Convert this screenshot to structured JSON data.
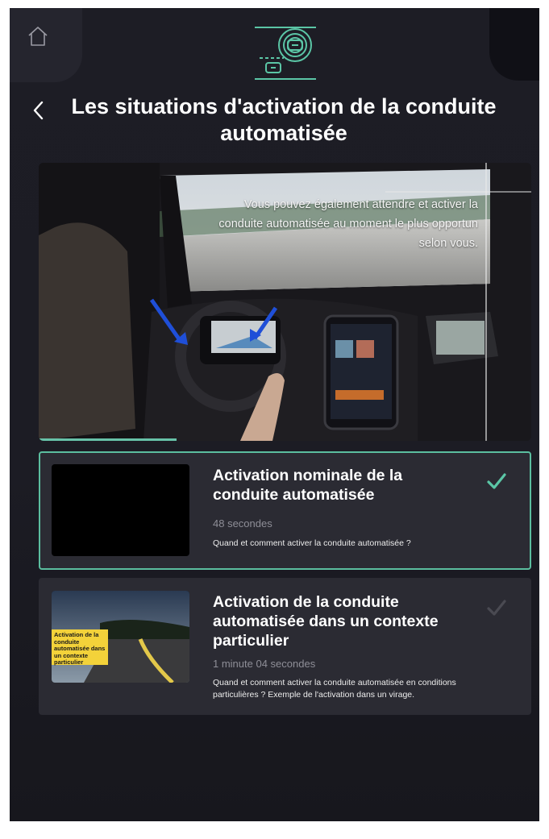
{
  "header": {
    "title": "Les situations d'activation de la conduite automatisée",
    "home_icon": "home-icon",
    "back_icon": "chevron-left-icon",
    "logo_icon": "autonomous-car-logo-icon"
  },
  "video": {
    "caption": "Vous pouvez également attendre et activer la conduite automatisée au moment le plus opportun selon vous.",
    "progress": 0.28,
    "accent_color": "#67c2a8"
  },
  "lessons": [
    {
      "title": "Activation nominale de la conduite automatisée",
      "duration": "48 secondes",
      "description": "Quand et comment activer la conduite automatisée ?",
      "completed": true,
      "active": true
    },
    {
      "title": "Activation de la conduite automatisée dans un contexte particulier",
      "duration": "1 minute 04 secondes",
      "description": "Quand et comment activer la conduite automatisée en conditions particulières ? Exemple de l'activation dans un virage.",
      "thumbnail_label": "Activation de la conduite automatisée dans un contexte particulier",
      "completed": false,
      "active": false
    }
  ],
  "colors": {
    "accent": "#5bbe9f",
    "background": "#1c1c24",
    "card": "#2b2b33"
  }
}
